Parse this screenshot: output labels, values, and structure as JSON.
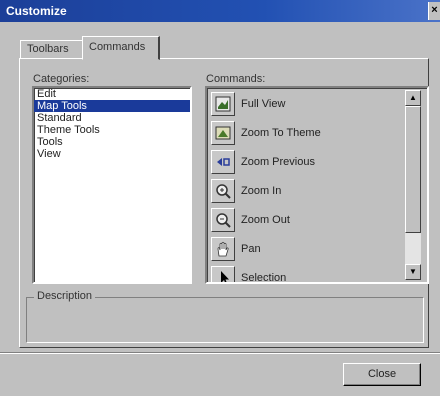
{
  "window": {
    "title": "Customize",
    "close_glyph": "×"
  },
  "tabs": [
    {
      "label": "Toolbars",
      "active": false
    },
    {
      "label": "Commands",
      "active": true
    }
  ],
  "categories": {
    "label": "Categories:",
    "items": [
      "Edit",
      "Map Tools",
      "Standard",
      "Theme Tools",
      "Tools",
      "View"
    ],
    "selected": "Map Tools"
  },
  "commands": {
    "label": "Commands:",
    "items": [
      {
        "label": "Full View",
        "icon": "full-view-icon"
      },
      {
        "label": "Zoom To Theme",
        "icon": "zoom-to-theme-icon"
      },
      {
        "label": "Zoom Previous",
        "icon": "zoom-previous-icon"
      },
      {
        "label": "Zoom In",
        "icon": "zoom-in-icon"
      },
      {
        "label": "Zoom Out",
        "icon": "zoom-out-icon"
      },
      {
        "label": "Pan",
        "icon": "pan-hand-icon"
      },
      {
        "label": "Selection",
        "icon": "selection-arrow-icon"
      }
    ]
  },
  "description": {
    "label": "Description"
  },
  "buttons": {
    "close": "Close"
  },
  "colors": {
    "titlebar": "#1c3f98",
    "selection": "#1a3a9a",
    "face": "#c0c0c0"
  }
}
